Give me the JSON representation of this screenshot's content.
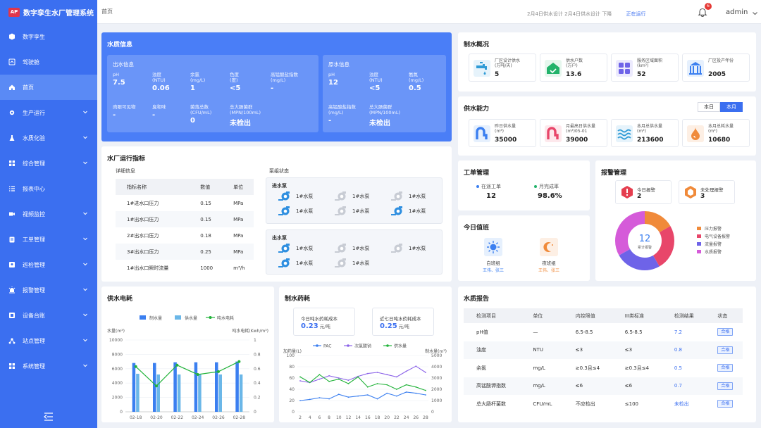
{
  "app": {
    "title": "数字孪生水厂管理系统",
    "logo_text": "AP"
  },
  "sidebar": {
    "items": [
      {
        "label": "数字孪生",
        "icon": "cube-icon",
        "expand": false
      },
      {
        "label": "驾驶舱",
        "icon": "dashboard-icon",
        "expand": false
      },
      {
        "label": "首页",
        "icon": "home-icon",
        "expand": false,
        "active": true
      },
      {
        "label": "生产运行",
        "icon": "gear-icon",
        "expand": true
      },
      {
        "label": "水质化验",
        "icon": "flask-icon",
        "expand": true
      },
      {
        "label": "综合管理",
        "icon": "grid-icon",
        "expand": true
      },
      {
        "label": "报表中心",
        "icon": "list-icon",
        "expand": false
      },
      {
        "label": "视频监控",
        "icon": "video-icon",
        "expand": true
      },
      {
        "label": "工单管理",
        "icon": "clipboard-icon",
        "expand": true
      },
      {
        "label": "巡检管理",
        "icon": "inspect-icon",
        "expand": true
      },
      {
        "label": "报警管理",
        "icon": "alarm-icon",
        "expand": true
      },
      {
        "label": "设备台账",
        "icon": "device-icon",
        "expand": true
      },
      {
        "label": "站点管理",
        "icon": "site-icon",
        "expand": true
      },
      {
        "label": "系统管理",
        "icon": "system-icon",
        "expand": true
      }
    ]
  },
  "topbar": {
    "breadcrumb": "首页",
    "marquee": "2月4日供水设计 2月4日供水设计 下降",
    "marquee_tag": "正在运行",
    "bell_count": "6",
    "user": "admin"
  },
  "water_quality": {
    "title": "水质信息",
    "outlet": {
      "title": "出水信息",
      "metrics": [
        {
          "label": "pH",
          "value": "7.5"
        },
        {
          "label": "浊度\n(NTU)",
          "value": "0.06"
        },
        {
          "label": "余氯\n(mg/L)",
          "value": "1"
        },
        {
          "label": "色度\n(度)",
          "value": "<5"
        },
        {
          "label": "高锰酸盐指数\n(mg/L)",
          "value": "-"
        },
        {
          "label": "肉眼可见物",
          "value": "-"
        },
        {
          "label": "臭和味",
          "value": "-"
        },
        {
          "label": "菌落总数\n(CFU/mL)",
          "value": "0"
        },
        {
          "label": "总大肠菌群\n(MPN/100mL)",
          "value": "未检出"
        }
      ]
    },
    "raw": {
      "title": "原水信息",
      "metrics": [
        {
          "label": "pH",
          "value": "12"
        },
        {
          "label": "浊度\n(NTU)",
          "value": "<5"
        },
        {
          "label": "氨氮\n(mg/L)",
          "value": "0.5"
        },
        {
          "label": "高锰酸盐指数\n(mg/L)",
          "value": "-"
        },
        {
          "label": "总大肠菌群\n(MPN/100mL)",
          "value": "未检出"
        }
      ]
    }
  },
  "operation": {
    "title": "水厂运行指标",
    "detail_title": "详细信息",
    "headers": [
      "指标名称",
      "数值",
      "单位"
    ],
    "rows": [
      [
        "1#进水口压力",
        "0.15",
        "MPa"
      ],
      [
        "1#出水口压力",
        "0.15",
        "MPa"
      ],
      [
        "2#出水口压力",
        "0.18",
        "MPa"
      ],
      [
        "3#出水口压力",
        "0.25",
        "MPa"
      ],
      [
        "1#出水口瞬时流量",
        "1000",
        "m³/h"
      ]
    ],
    "pump_title": "泵组状态",
    "inlet_title": "进水泵",
    "outlet_title": "出水泵",
    "inlet_pumps": [
      {
        "label": "1#水泵",
        "on": true
      },
      {
        "label": "1#水泵",
        "on": false
      },
      {
        "label": "1#水泵",
        "on": false
      },
      {
        "label": "1#水泵",
        "on": true
      },
      {
        "label": "1#水泵",
        "on": false
      },
      {
        "label": "1#水泵",
        "on": true
      }
    ],
    "outlet_pumps": [
      {
        "label": "1#水泵",
        "on": true
      },
      {
        "label": "1#水泵",
        "on": false
      },
      {
        "label": "1#水泵",
        "on": false
      },
      {
        "label": "1#水泵",
        "on": true
      },
      {
        "label": "1#水泵",
        "on": false
      }
    ]
  },
  "overview": {
    "title": "制水概况",
    "items": [
      {
        "label": "厂区设计供水\n(万吨/天)",
        "value": "5",
        "icon": "tap-icon",
        "color": "#e6f3fb",
        "fg": "#2f9bd6"
      },
      {
        "label": "供水户数\n(万户)",
        "value": "13.6",
        "icon": "house-icon",
        "color": "#e6f7ee",
        "fg": "#22b36b"
      },
      {
        "label": "服务区域面积\n(km²)",
        "value": "52",
        "icon": "grid-icon",
        "color": "#eceafd",
        "fg": "#6e63e8"
      },
      {
        "label": "厂区投产年份",
        "value": "2005",
        "icon": "factory-icon",
        "color": "#e6f0fd",
        "fg": "#3b7ff0"
      }
    ]
  },
  "capacity": {
    "title": "供水能力",
    "tabs": [
      "本日",
      "本月"
    ],
    "items": [
      {
        "label": "昨日供水量\n(m³)",
        "value": "35000",
        "icon": "pipe-icon",
        "color": "#e6f0fd",
        "fg": "#3b7ff0"
      },
      {
        "label": "月最高日供水量\n(m³)05-01",
        "value": "39000",
        "icon": "pipe-icon",
        "color": "#fde8ec",
        "fg": "#e8466a"
      },
      {
        "label": "本月总供水量\n(m³)",
        "value": "213600",
        "icon": "wave-icon",
        "color": "#e6f3fb",
        "fg": "#2f9bd6"
      },
      {
        "label": "本月总耗水量\n(m³)",
        "value": "10680",
        "icon": "drop-icon",
        "color": "#fdefe4",
        "fg": "#f08a3a"
      }
    ]
  },
  "workorder": {
    "title": "工单管理",
    "items": [
      {
        "label": "在途工单",
        "value": "12",
        "dot": "#3b7ff0"
      },
      {
        "label": "月完成率",
        "value": "98.6%",
        "dot": "#22b36b"
      }
    ]
  },
  "duty": {
    "title": "今日值班",
    "items": [
      {
        "label": "白班组",
        "members": "王伟、张三",
        "icon": "sun-icon",
        "color": "#e6f0fd",
        "fg": "#3b7ff0"
      },
      {
        "label": "夜班组",
        "members": "王伟、张三",
        "icon": "moon-icon",
        "color": "#fdefe4",
        "fg": "#f08a3a"
      }
    ]
  },
  "alarm": {
    "title": "报警管理",
    "items": [
      {
        "label": "今日报警",
        "value": "2",
        "color": "#e53e4f"
      },
      {
        "label": "未处理报警",
        "value": "3",
        "color": "#f08a3a"
      }
    ],
    "donut_value": "12",
    "donut_label": "累计报警",
    "legend": [
      {
        "label": "压力报警",
        "color": "#f08a3a",
        "value": 2
      },
      {
        "label": "电气设备报警",
        "color": "#e8466a",
        "value": 3
      },
      {
        "label": "流量报警",
        "color": "#6e63e8",
        "value": 3
      },
      {
        "label": "水质报警",
        "color": "#d55bd9",
        "value": 4
      }
    ]
  },
  "power": {
    "title": "供水电耗",
    "chart_data": {
      "type": "bar",
      "categories": [
        "02-18",
        "02-20",
        "02-22",
        "02-24",
        "02-26",
        "02-28"
      ],
      "series": [
        {
          "name": "制水量",
          "kind": "bar",
          "color": "#3b7ff0",
          "values": [
            6800,
            6800,
            6900,
            6900,
            6900,
            7000
          ]
        },
        {
          "name": "供水量",
          "kind": "bar",
          "color": "#6bb7e8",
          "values": [
            5300,
            5200,
            5200,
            5200,
            5200,
            5200
          ]
        },
        {
          "name": "吨水电耗",
          "kind": "line",
          "color": "#22b33a",
          "values": [
            0.63,
            0.36,
            0.65,
            0.52,
            0.56,
            0.7
          ]
        }
      ],
      "ylabel": "水量(m³)",
      "y2label": "吨水电耗(Kwh/m³)",
      "ylim": [
        0,
        10000
      ],
      "y2lim": [
        0,
        1
      ],
      "yticks": [
        "0",
        "2000",
        "4000",
        "6000",
        "8000",
        "10000"
      ],
      "y2ticks": [
        "0",
        "0.2",
        "0.4",
        "0.6",
        "0.8",
        "1"
      ],
      "legend_position": "top"
    }
  },
  "chemical": {
    "title": "制水药耗",
    "cost_boxes": [
      {
        "label": "今日吨水药耗成本",
        "value": "0.23",
        "unit": "元/吨"
      },
      {
        "label": "近七日吨水药耗成本",
        "value": "0.25",
        "unit": "元/吨"
      }
    ],
    "chart_data": {
      "type": "line",
      "x": [
        "2",
        "4",
        "6",
        "8",
        "10",
        "12",
        "14",
        "16",
        "18",
        "20",
        "22",
        "24",
        "26",
        "28"
      ],
      "series": [
        {
          "name": "PAC",
          "color": "#3b7ff0",
          "axis": "left",
          "values": [
            20,
            22,
            25,
            23,
            31,
            26,
            28,
            30,
            23,
            33,
            28,
            35,
            33,
            30
          ]
        },
        {
          "name": "次氯酸钠",
          "color": "#8b63e8",
          "axis": "left",
          "values": [
            55,
            52,
            58,
            64,
            60,
            56,
            63,
            68,
            70,
            66,
            62,
            72,
            81,
            70
          ]
        },
        {
          "name": "供水量",
          "color": "#22b33a",
          "axis": "right",
          "values": [
            3100,
            2600,
            3300,
            2700,
            2900,
            2500,
            3100,
            2200,
            2500,
            2400,
            2000,
            2400,
            2200,
            1900
          ]
        }
      ],
      "ylabel": "加药量(L)",
      "y2label": "制水量(m³)",
      "ylim": [
        0,
        100
      ],
      "y2lim": [
        0,
        5000
      ],
      "yticks": [
        "0",
        "20",
        "40",
        "60",
        "80",
        "100"
      ],
      "y2ticks": [
        "0",
        "1000",
        "2000",
        "3000",
        "4000",
        "5000"
      ],
      "legend_position": "top"
    }
  },
  "report": {
    "title": "水质报告",
    "headers": [
      "检测项目",
      "单位",
      "内控限值",
      "III类标准",
      "检测结果",
      "状态"
    ],
    "rows": [
      [
        "pH值",
        "—",
        "6.5-8.5",
        "6.5-8.5",
        "7.2",
        "合格"
      ],
      [
        "浊度",
        "NTU",
        "≤3",
        "≤3",
        "0.8",
        "合格"
      ],
      [
        "余氯",
        "mg/L",
        "≥0.3且≤4",
        "≥0.3且≤4",
        "0.5",
        "合格"
      ],
      [
        "高锰酸钾指数",
        "mg/L",
        "≤6",
        "≤6",
        "0.7",
        "合格"
      ],
      [
        "总大肠杆菌数",
        "CFU/mL",
        "不应检出",
        "≤100",
        "未检出",
        "合格"
      ]
    ]
  }
}
